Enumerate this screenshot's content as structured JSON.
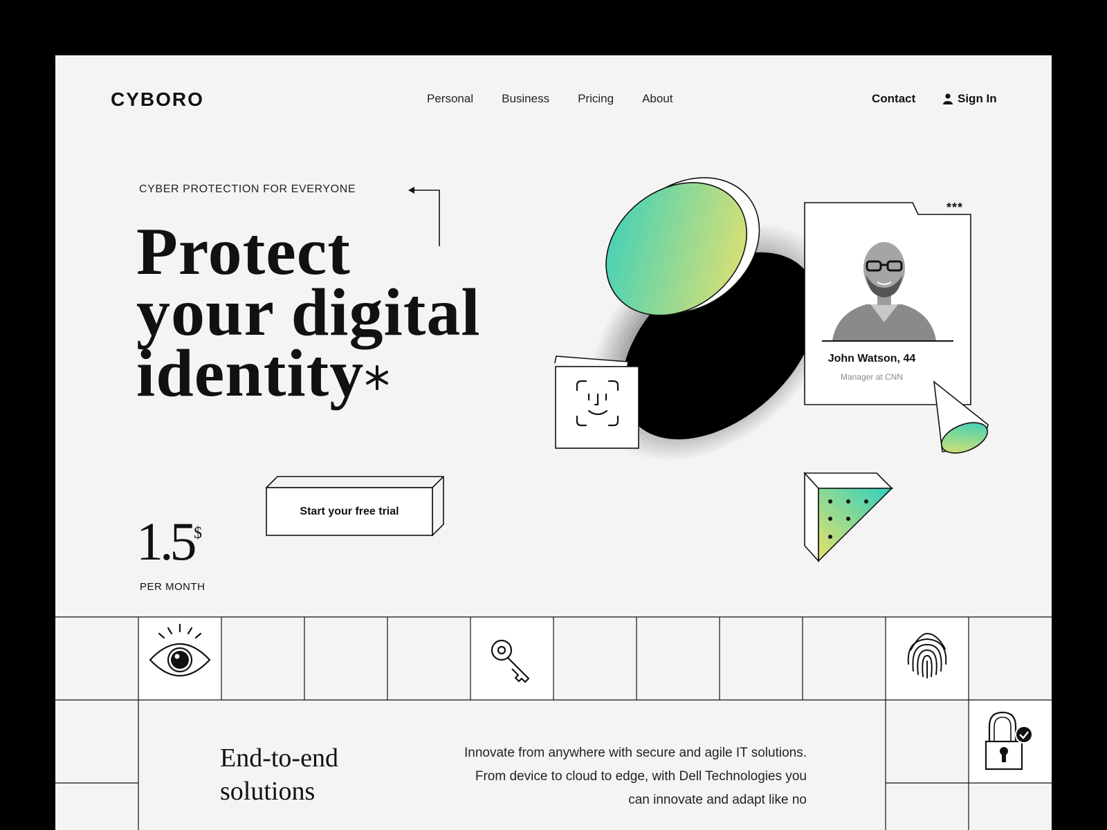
{
  "brand": {
    "logo": "CYBORO"
  },
  "nav": {
    "items": [
      "Personal",
      "Business",
      "Pricing",
      "About"
    ],
    "contact": "Contact",
    "sign_in": "Sign In"
  },
  "hero": {
    "eyebrow": "CYBER PROTECTION FOR EVERYONE",
    "headline": [
      "Protect",
      "your digital",
      "identity"
    ],
    "price": "1.5",
    "currency": "$",
    "per_month": "PER MONTH",
    "cta": "Start your free trial"
  },
  "profile_card": {
    "name": "John Watson, 44",
    "role": "Manager at CNN",
    "dots": "***"
  },
  "icons": [
    "eye-icon",
    "key-icon",
    "fingerprint-icon",
    "lock-check-icon",
    "face-id-icon",
    "user-icon",
    "arrow-left-icon",
    "asterisk-icon"
  ],
  "section": {
    "title": [
      "End-to-end",
      "solutions"
    ],
    "body": "Innovate from anywhere with secure and agile IT solutions. From device to cloud to edge, with Dell Technologies you can innovate and adapt like no"
  },
  "colors": {
    "frame_bg": "#f4f4f4",
    "gradient_start": "#2ecfc0",
    "gradient_end": "#f2e26a",
    "ink": "#111111"
  }
}
